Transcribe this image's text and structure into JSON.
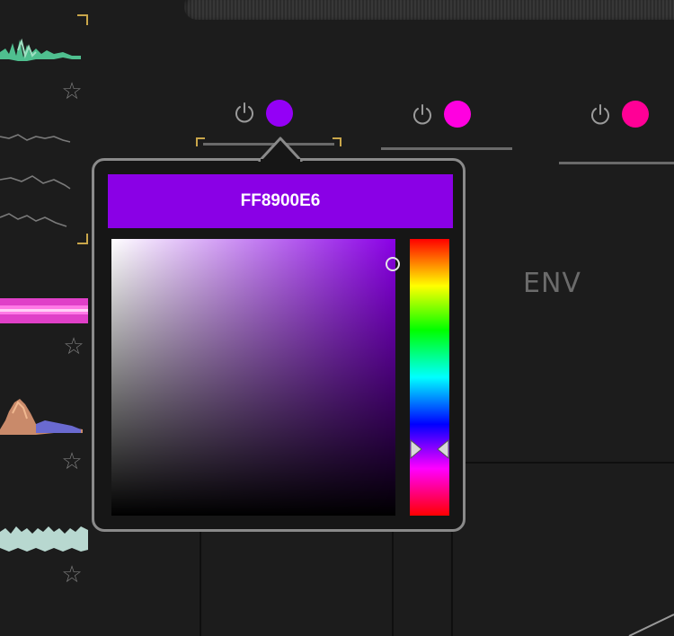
{
  "picker": {
    "hex_value": "FF8900E6",
    "bar_color": "#8a00e6",
    "hue_color": "#8a00e6",
    "hue_fraction": 0.76,
    "saturation": 0.99,
    "brightness": 0.91
  },
  "slots": [
    {
      "dot_color": "#9400f6",
      "power_icon": "power-icon",
      "color": "purple"
    },
    {
      "dot_color": "#ff00e0",
      "power_icon": "power-icon",
      "color": "magenta"
    },
    {
      "dot_color": "#ff0096",
      "power_icon": "power-icon",
      "color": "pink"
    }
  ],
  "env_label": "ENV",
  "colors": {
    "background": "#1c1c1c",
    "popover_border": "#8a8a8a",
    "corner_bracket": "#c9a64a",
    "star": "#7a7a7a"
  }
}
